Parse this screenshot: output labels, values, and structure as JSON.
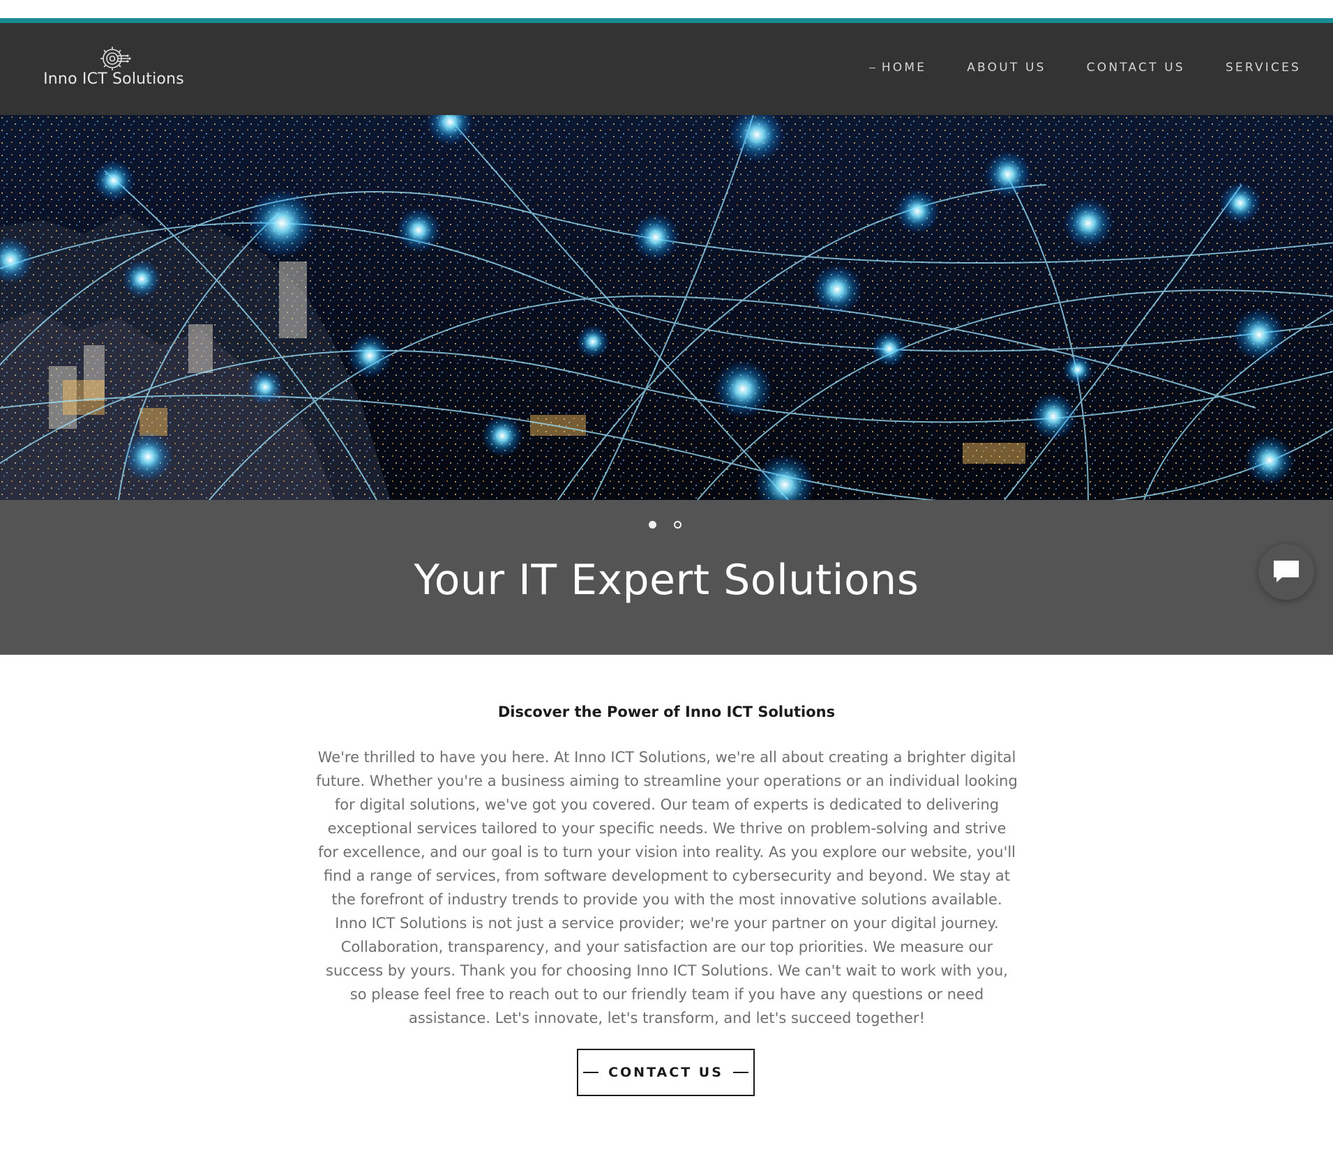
{
  "brand": {
    "name": "Inno ICT Solutions",
    "logo_icon": "gear-circuit-icon"
  },
  "nav": {
    "items": [
      {
        "label": "HOME",
        "active": true
      },
      {
        "label": "ABOUT US",
        "active": false
      },
      {
        "label": "CONTACT US",
        "active": false
      },
      {
        "label": "SERVICES",
        "active": false
      }
    ]
  },
  "hero": {
    "image": "night-city-network-connections",
    "slide_count": 2,
    "active_slide": 1,
    "title": "Your IT Expert Solutions"
  },
  "chat": {
    "icon": "chat-bubble-icon"
  },
  "intro": {
    "heading": "Discover the Power of Inno ICT Solutions",
    "body": "We're thrilled to have you here. At Inno ICT Solutions, we're all about creating a brighter digital future. Whether you're a business aiming to streamline your operations or an individual looking for digital solutions, we've got you covered. Our team of experts is dedicated to delivering exceptional services tailored to your specific needs. We thrive on problem-solving and strive for excellence, and our goal is to turn your vision into reality. As you explore our website, you'll find a range of services, from software development to cybersecurity and beyond. We stay at the forefront of industry trends to provide you with the most innovative solutions available. Inno ICT Solutions is not just a service provider; we're your partner on your digital journey. Collaboration, transparency, and your satisfaction are our top priorities. We measure our success by yours. Thank you for choosing Inno ICT Solutions. We can't wait to work with you, so please feel free to reach out to our friendly team if you have any questions or need assistance. Let's innovate, let's transform, and let's succeed together!",
    "cta_label": "CONTACT US"
  },
  "colors": {
    "accent": "#1a8c95",
    "header_bg": "#333333",
    "caption_bg": "#545454"
  }
}
